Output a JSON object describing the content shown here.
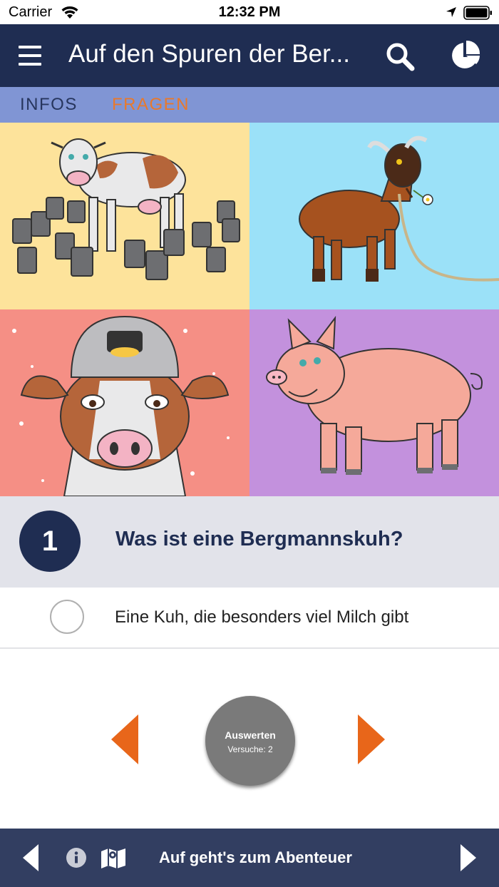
{
  "status_bar": {
    "carrier": "Carrier",
    "time": "12:32 PM"
  },
  "header": {
    "title": "Auf den Spuren der Ber...",
    "menu_icon": "hamburger-menu-icon",
    "search_icon": "search-icon",
    "stats_icon": "pie-chart-icon"
  },
  "tabs": [
    {
      "label": "INFOS",
      "active": false
    },
    {
      "label": "FRAGEN",
      "active": true
    }
  ],
  "answer_images": [
    "cow-with-milk-cans",
    "goat-with-flower",
    "cow-with-miner-helmet",
    "pig"
  ],
  "question": {
    "number": "1",
    "text": "Was ist eine Bergmannskuh?"
  },
  "answers": [
    {
      "text": "Eine Kuh, die besonders viel Milch gibt",
      "selected": false
    }
  ],
  "controls": {
    "evaluate_label": "Auswerten",
    "attempts_label": "Versuche: 2"
  },
  "bottom_bar": {
    "label": "Auf geht's zum Abenteuer"
  },
  "colors": {
    "header": "#1f2d52",
    "tab_bar": "#8095d4",
    "active_tab": "#e8792c",
    "arrow": "#e8661a",
    "bottom_bar": "#323e61"
  }
}
